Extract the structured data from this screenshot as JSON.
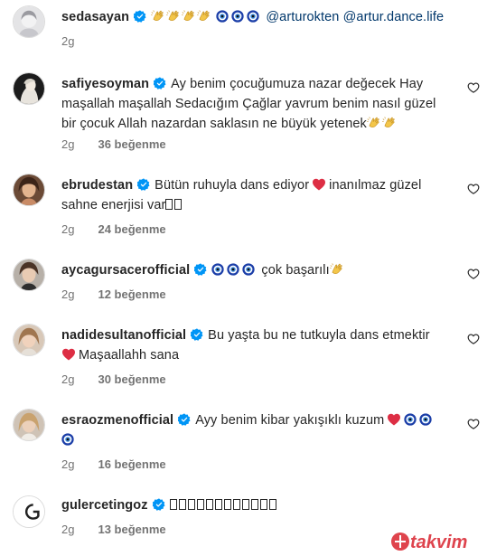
{
  "comments": [
    {
      "username": "sedasayan",
      "text": "@arturokten @artur.dance.life",
      "time": "2g",
      "likes": ""
    },
    {
      "username": "safiyesoyman",
      "line1": "Ay benim çocuğumuza nazar değecek Hay",
      "line2": "maşallah maşallah Sedacığım Çağlar yavrum benim nasıl güzel",
      "line3": "bir çocuk Allah nazardan saklasın ne büyük yetenek",
      "time": "2g",
      "likes": "36 beğenme"
    },
    {
      "username": "ebrudestan",
      "line1a": "Bütün ruhuyla dans ediyor",
      "line1b": "inanılmaz güzel",
      "line2": "sahne enerjisi var",
      "time": "2g",
      "likes": "24 beğenme"
    },
    {
      "username": "aycagursacerofficial",
      "text": "çok başarılı",
      "time": "2g",
      "likes": "12 beğenme"
    },
    {
      "username": "nadidesultanofficial",
      "line1": "Bu yaşta bu ne tutkuyla dans etmektir",
      "line2": "Maşaallahh sana",
      "time": "2g",
      "likes": "30 beğenme"
    },
    {
      "username": "esraozmenofficial",
      "text": "Ayy benim kibar yakışıklı kuzum",
      "time": "2g",
      "likes": "16 beğenme"
    },
    {
      "username": "gulercetingoz",
      "time": "2g",
      "likes": "13 beğenme"
    }
  ],
  "watermark": "takvim",
  "colors": {
    "verified": "#0095f6",
    "mention": "#00376b",
    "meta": "#737373",
    "heart": "#e0245e",
    "watermark": "#d9232e"
  },
  "icons": {
    "verified": "verified-badge-icon",
    "like": "heart-outline-icon",
    "nazar": "nazar-boncugu-icon",
    "clap": "clapping-hands-icon",
    "heart": "red-heart-icon"
  }
}
